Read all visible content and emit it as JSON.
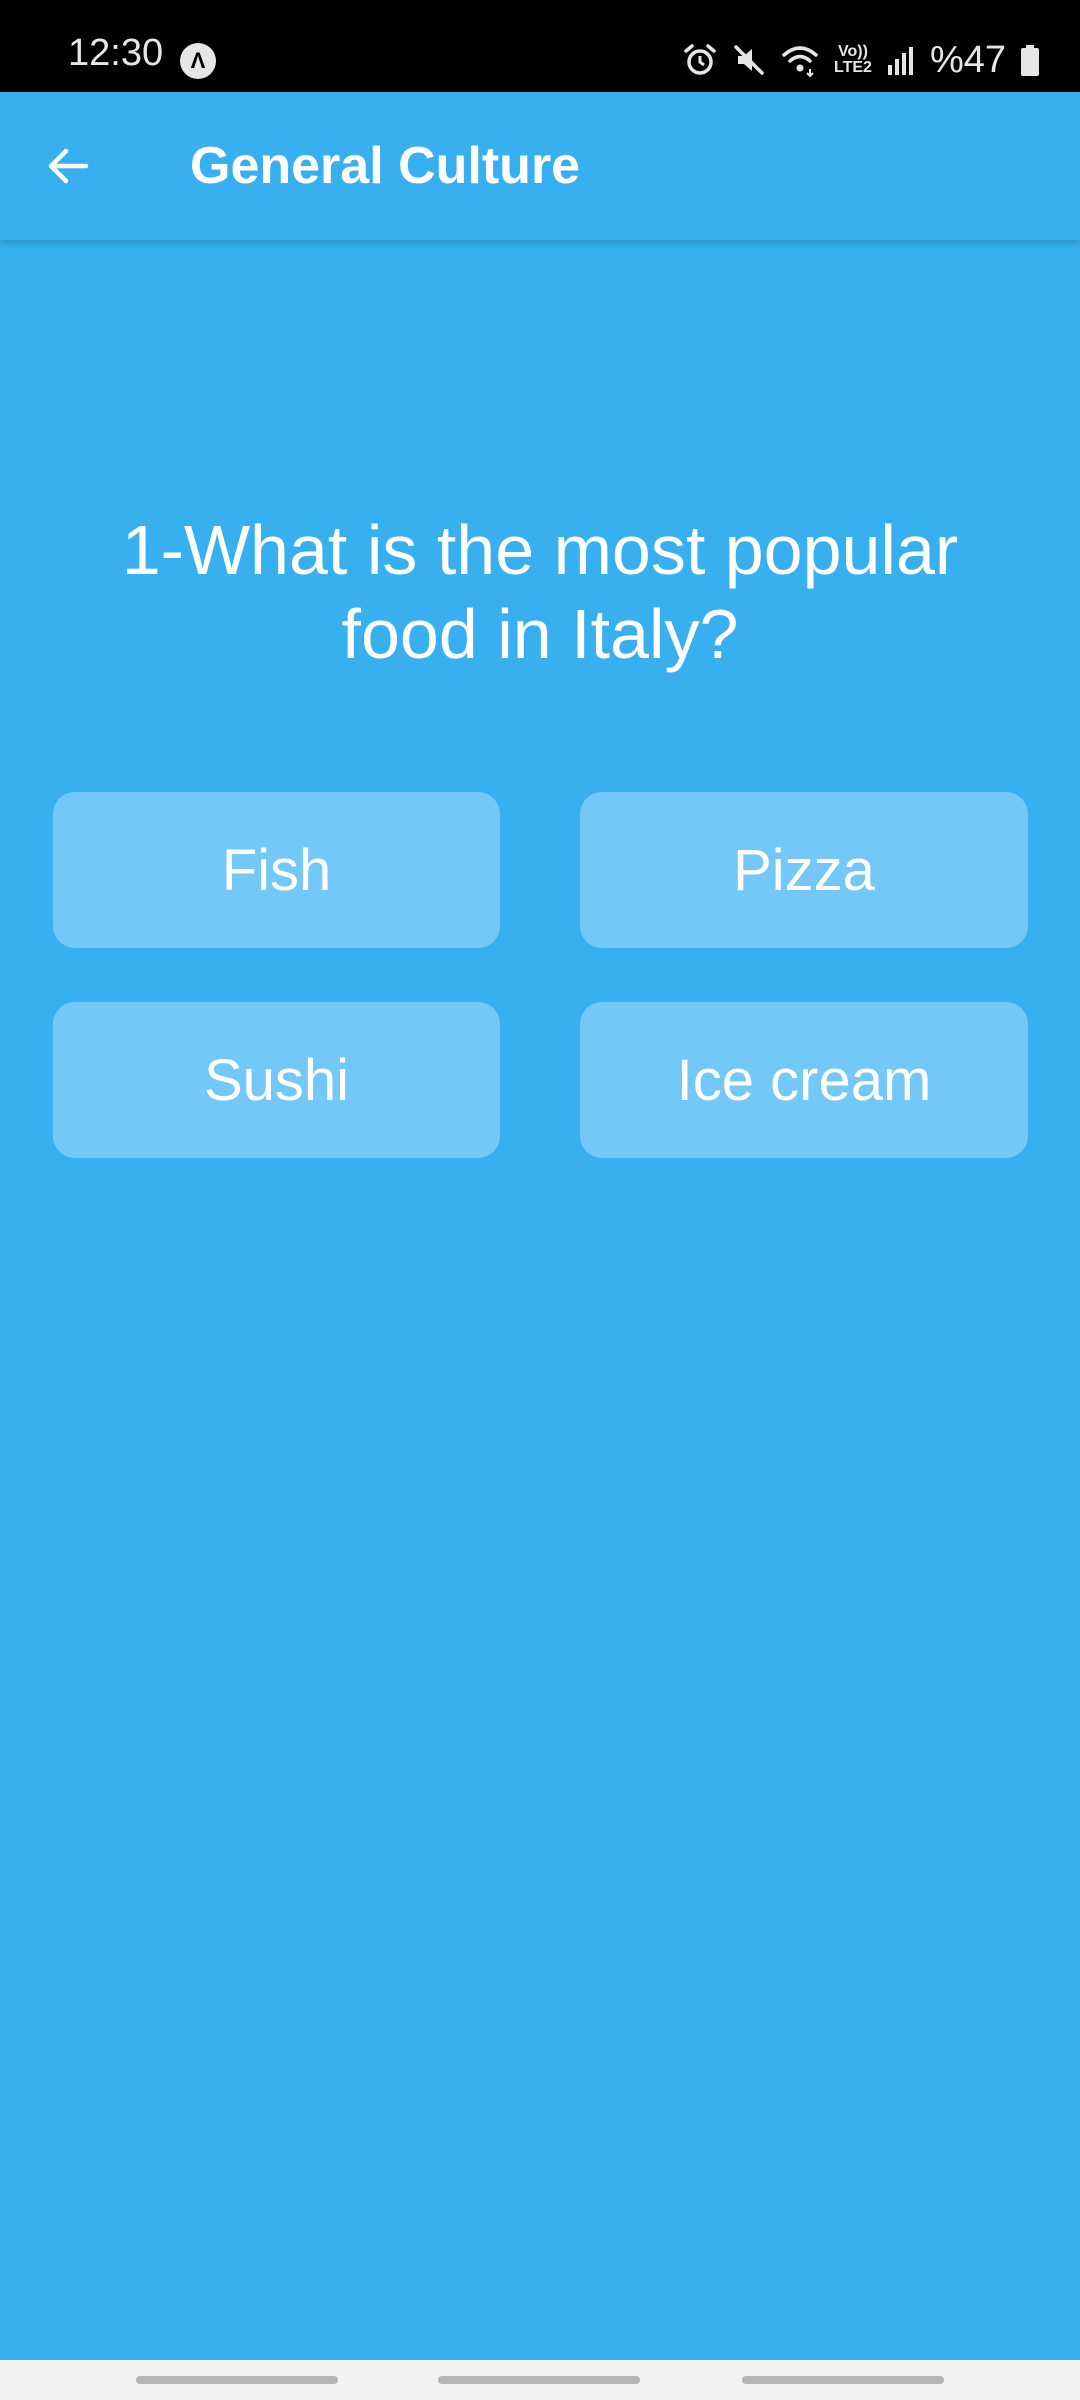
{
  "status_bar": {
    "time": "12:30",
    "app_badge": "Λ",
    "volte_line1": "Vo))",
    "volte_line2": "LTE2",
    "battery_percent": "%47",
    "icons": [
      "alarm-icon",
      "mute-icon",
      "wifi-icon",
      "volte-icon",
      "signal-icon",
      "battery-icon"
    ]
  },
  "app_bar": {
    "title": "General Culture",
    "back_icon": "back-arrow-icon"
  },
  "quiz": {
    "question": "1-What is the most popular food in Italy?",
    "answers": [
      "Fish",
      "Pizza",
      "Sushi",
      "Ice cream"
    ]
  },
  "colors": {
    "background": "#38b0f0",
    "answer_button": "#74c8f8",
    "text": "#ffffff",
    "status_bar": "#000000"
  }
}
